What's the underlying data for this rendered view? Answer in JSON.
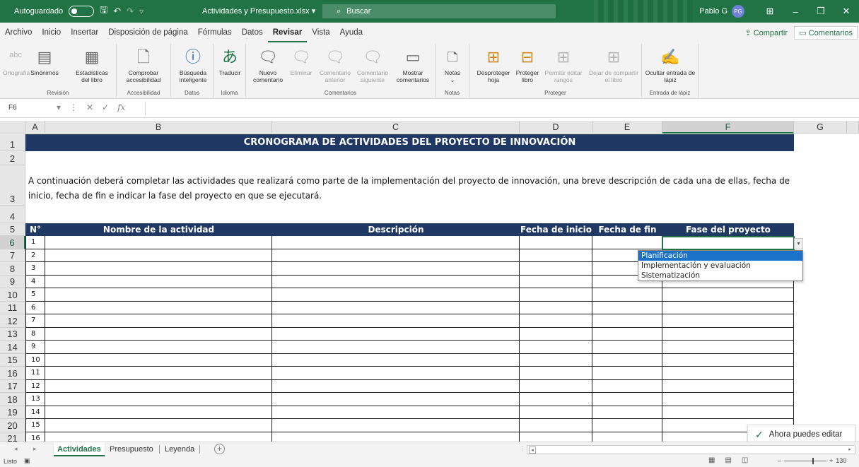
{
  "titlebar": {
    "autosave_label": "Autoguardado",
    "filename": "Actividades y Presupuesto.xlsx",
    "filename_chevron": "▾",
    "search_placeholder": "Buscar",
    "user_name": "Pablo G",
    "user_initials": "PG",
    "colors": {
      "bar": "#217346",
      "avatar": "#6f7fd8"
    }
  },
  "menu": {
    "items": [
      "Archivo",
      "Inicio",
      "Insertar",
      "Disposición de página",
      "Fórmulas",
      "Datos",
      "Revisar",
      "Vista",
      "Ayuda"
    ],
    "active": "Revisar",
    "share_label": "Compartir",
    "comments_label": "Comentarios"
  },
  "ribbon": {
    "groups": {
      "revision": "Revisión",
      "accesibilidad": "Accesibilidad",
      "datos": "Datos",
      "idioma": "Idioma",
      "comentarios": "Comentarios",
      "notas": "Notas",
      "proteger": "Proteger",
      "entrada_lapiz": "Entrada de lápiz"
    },
    "buttons": {
      "ortografia": "Ortografía",
      "ortografia_icon": "abc",
      "sinonimos": "Sinónimos",
      "estadisticas": "Estadísticas del libro",
      "comprobar": "Comprobar accesibilidad",
      "busqueda": "Búsqueda inteligente",
      "traducir": "Traducir",
      "nuevo_comentario": "Nuevo comentario",
      "eliminar": "Eliminar",
      "anterior": "Comentario anterior",
      "siguiente": "Comentario siguiente",
      "mostrar": "Mostrar comentarios",
      "notas": "Notas",
      "desproteger": "Desproteger hoja",
      "proteger_libro": "Proteger libro",
      "permitir": "Permitir editar rangos",
      "dejar": "Dejar de compartir el libro",
      "ocultar": "Ocultar entrada de lápiz"
    }
  },
  "formula_bar": {
    "name_box": "F6",
    "fx": "fx",
    "value": ""
  },
  "columns": [
    "A",
    "B",
    "C",
    "D",
    "E",
    "F",
    "G"
  ],
  "selected_column": "F",
  "selected_row": "6",
  "rows": [
    "1",
    "2",
    "3",
    "4",
    "5",
    "6",
    "7",
    "8",
    "9",
    "10",
    "11",
    "12",
    "13",
    "14",
    "15",
    "16",
    "17",
    "18",
    "19",
    "20",
    "21"
  ],
  "sheet": {
    "title": "CRONOGRAMA DE ACTIVIDADES DEL PROYECTO DE INNOVACIÓN",
    "intro": "A continuación deberá completar las actividades que realizará como parte de la implementación del proyecto de innovación, una breve descripción de cada una de ellas, fecha de inicio, fecha de fin e indicar la fase del proyecto en que se ejecutará.",
    "headers": [
      "N°",
      "Nombre de la actividad",
      "Descripción",
      "Fecha de inicio",
      "Fecha de fin",
      "Fase del proyecto"
    ],
    "numbers": [
      "1",
      "2",
      "3",
      "4",
      "5",
      "6",
      "7",
      "8",
      "9",
      "10",
      "11",
      "12",
      "13",
      "14",
      "15",
      "16"
    ],
    "header_color": "#1f3864"
  },
  "dropdown": {
    "options": [
      "Planificación",
      "Implementación y evaluación",
      "Sistematización"
    ],
    "selected": "Planificación"
  },
  "toast": {
    "text": "Ahora puedes editar"
  },
  "tabs": {
    "items": [
      "Actividades",
      "Presupuesto",
      "Leyenda"
    ],
    "active": "Actividades",
    "add_label": "+"
  },
  "status": {
    "text": "Listo",
    "zoom": "130"
  }
}
